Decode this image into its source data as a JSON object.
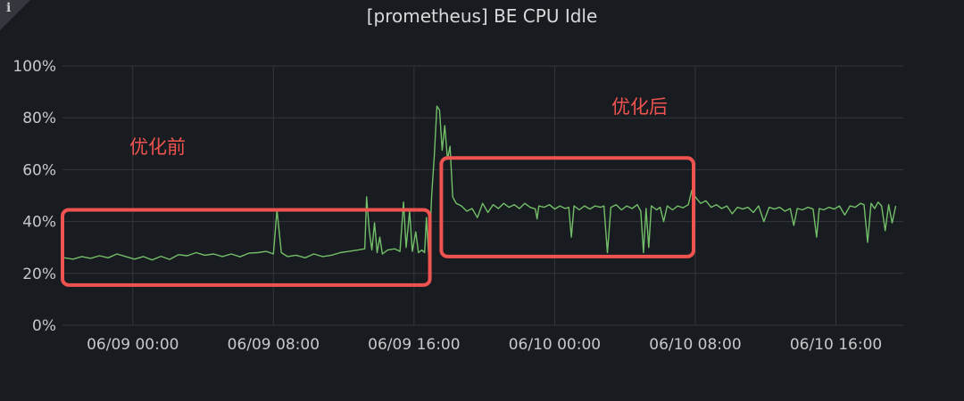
{
  "panel": {
    "title": "[prometheus] BE CPU Idle",
    "info_icon": "info-icon"
  },
  "chart_data": {
    "type": "line",
    "title": "[prometheus] BE CPU Idle",
    "xlabel": "",
    "ylabel": "",
    "ylim": [
      0,
      100
    ],
    "y_unit": "%",
    "x_range": [
      "06/08 20:00",
      "06/10 17:50"
    ],
    "grid": true,
    "legend": "none",
    "line_color": "#73bf69",
    "y_ticks": [
      {
        "value": 0,
        "label": "0%"
      },
      {
        "value": 20,
        "label": "20%"
      },
      {
        "value": 40,
        "label": "40%"
      },
      {
        "value": 60,
        "label": "60%"
      },
      {
        "value": 80,
        "label": "80%"
      },
      {
        "value": 100,
        "label": "100%"
      }
    ],
    "x_ticks": [
      {
        "label": "06/09 00:00",
        "hours": 4
      },
      {
        "label": "06/09 08:00",
        "hours": 12
      },
      {
        "label": "06/09 16:00",
        "hours": 20
      },
      {
        "label": "06/10 00:00",
        "hours": 28
      },
      {
        "label": "06/10 08:00",
        "hours": 36
      },
      {
        "label": "06/10 16:00",
        "hours": 44
      }
    ],
    "series": [
      {
        "points": [
          [
            0.1,
            26
          ],
          [
            0.6,
            25.5
          ],
          [
            1.1,
            26.5
          ],
          [
            1.6,
            25.8
          ],
          [
            2.1,
            26.8
          ],
          [
            2.6,
            26
          ],
          [
            3.1,
            27.5
          ],
          [
            3.6,
            26.5
          ],
          [
            4.1,
            25.5
          ],
          [
            4.6,
            26.5
          ],
          [
            5.1,
            25.2
          ],
          [
            5.6,
            26.6
          ],
          [
            6.1,
            25.4
          ],
          [
            6.6,
            27.2
          ],
          [
            7.1,
            26.8
          ],
          [
            7.6,
            28
          ],
          [
            8.1,
            27
          ],
          [
            8.6,
            27.5
          ],
          [
            9.1,
            26.5
          ],
          [
            9.6,
            27.5
          ],
          [
            10.1,
            26.4
          ],
          [
            10.6,
            27.8
          ],
          [
            11.1,
            28
          ],
          [
            11.6,
            28.5
          ],
          [
            12.0,
            27.5
          ],
          [
            12.2,
            44.5
          ],
          [
            12.45,
            28
          ],
          [
            12.8,
            26.5
          ],
          [
            13.3,
            27
          ],
          [
            13.8,
            26
          ],
          [
            14.3,
            27.5
          ],
          [
            14.8,
            26.5
          ],
          [
            15.3,
            27
          ],
          [
            15.8,
            28
          ],
          [
            16.3,
            28.5
          ],
          [
            16.8,
            29
          ],
          [
            17.2,
            29.5
          ],
          [
            17.3,
            49.5
          ],
          [
            17.45,
            36.5
          ],
          [
            17.6,
            29
          ],
          [
            17.75,
            39.5
          ],
          [
            17.9,
            28
          ],
          [
            18.05,
            34
          ],
          [
            18.2,
            27.5
          ],
          [
            18.5,
            29
          ],
          [
            18.9,
            29.5
          ],
          [
            19.2,
            28.5
          ],
          [
            19.4,
            47.5
          ],
          [
            19.55,
            30
          ],
          [
            19.75,
            44
          ],
          [
            19.9,
            28.5
          ],
          [
            20.1,
            36
          ],
          [
            20.25,
            28
          ],
          [
            20.45,
            29
          ],
          [
            20.6,
            28
          ],
          [
            20.7,
            41.5
          ],
          [
            20.85,
            25
          ],
          [
            21.0,
            50
          ],
          [
            21.15,
            65
          ],
          [
            21.3,
            84.5
          ],
          [
            21.45,
            83
          ],
          [
            21.6,
            67.5
          ],
          [
            21.75,
            77
          ],
          [
            21.9,
            64
          ],
          [
            22.05,
            69
          ],
          [
            22.2,
            49.5
          ],
          [
            22.4,
            47
          ],
          [
            22.7,
            46
          ],
          [
            23.0,
            44
          ],
          [
            23.3,
            45
          ],
          [
            23.6,
            41.5
          ],
          [
            23.9,
            47
          ],
          [
            24.2,
            43.5
          ],
          [
            24.5,
            46.5
          ],
          [
            24.8,
            45
          ],
          [
            25.1,
            47
          ],
          [
            25.4,
            45.5
          ],
          [
            25.7,
            46.5
          ],
          [
            26.0,
            45
          ],
          [
            26.3,
            47
          ],
          [
            26.6,
            45.5
          ],
          [
            26.9,
            44.8
          ],
          [
            27.0,
            41
          ],
          [
            27.1,
            46
          ],
          [
            27.4,
            45.5
          ],
          [
            27.7,
            46.5
          ],
          [
            28.0,
            44.8
          ],
          [
            28.3,
            46
          ],
          [
            28.6,
            45
          ],
          [
            28.8,
            45.5
          ],
          [
            28.95,
            34
          ],
          [
            29.1,
            46
          ],
          [
            29.4,
            44.5
          ],
          [
            29.7,
            46
          ],
          [
            30.0,
            44.8
          ],
          [
            30.3,
            46
          ],
          [
            30.6,
            45.5
          ],
          [
            30.8,
            46
          ],
          [
            31.0,
            28
          ],
          [
            31.2,
            45.5
          ],
          [
            31.5,
            46.5
          ],
          [
            31.8,
            44.5
          ],
          [
            32.1,
            46
          ],
          [
            32.4,
            45
          ],
          [
            32.7,
            46.5
          ],
          [
            32.9,
            44
          ],
          [
            33.05,
            28
          ],
          [
            33.2,
            45
          ],
          [
            33.35,
            30
          ],
          [
            33.5,
            46
          ],
          [
            33.8,
            44.5
          ],
          [
            34.0,
            45.5
          ],
          [
            34.2,
            40
          ],
          [
            34.4,
            46
          ],
          [
            34.7,
            44.5
          ],
          [
            35.0,
            46
          ],
          [
            35.3,
            45.3
          ],
          [
            35.6,
            46.5
          ],
          [
            35.8,
            52
          ],
          [
            36.0,
            49.5
          ],
          [
            36.3,
            47
          ],
          [
            36.6,
            48
          ],
          [
            36.9,
            45.5
          ],
          [
            37.2,
            46.5
          ],
          [
            37.5,
            45
          ],
          [
            37.8,
            46
          ],
          [
            38.1,
            43
          ],
          [
            38.4,
            45.5
          ],
          [
            38.7,
            44.8
          ],
          [
            39.0,
            45.5
          ],
          [
            39.3,
            43.5
          ],
          [
            39.6,
            46
          ],
          [
            39.9,
            40
          ],
          [
            40.2,
            45.5
          ],
          [
            40.5,
            44.8
          ],
          [
            40.8,
            45.5
          ],
          [
            41.1,
            44
          ],
          [
            41.4,
            45
          ],
          [
            41.6,
            38.5
          ],
          [
            41.8,
            45
          ],
          [
            42.1,
            44.5
          ],
          [
            42.4,
            45.5
          ],
          [
            42.7,
            44.8
          ],
          [
            42.9,
            34
          ],
          [
            43.05,
            45
          ],
          [
            43.3,
            44.5
          ],
          [
            43.6,
            45.5
          ],
          [
            43.9,
            44.8
          ],
          [
            44.2,
            46
          ],
          [
            44.5,
            42.5
          ],
          [
            44.8,
            46
          ],
          [
            45.1,
            45.5
          ],
          [
            45.4,
            47
          ],
          [
            45.6,
            46.5
          ],
          [
            45.8,
            32
          ],
          [
            46.0,
            47
          ],
          [
            46.2,
            45
          ],
          [
            46.4,
            47.5
          ],
          [
            46.6,
            46
          ],
          [
            46.8,
            36.5
          ],
          [
            47.0,
            46.5
          ],
          [
            47.2,
            39.5
          ],
          [
            47.4,
            46
          ]
        ]
      }
    ],
    "annotations": [
      {
        "text": "优化前",
        "box": {
          "x0": 0.0,
          "x1": 20.9,
          "y0": 15.5,
          "y1": 44.5
        }
      },
      {
        "text": "优化后",
        "box": {
          "x0": 21.55,
          "x1": 35.9,
          "y0": 26.5,
          "y1": 64.5
        }
      }
    ]
  }
}
